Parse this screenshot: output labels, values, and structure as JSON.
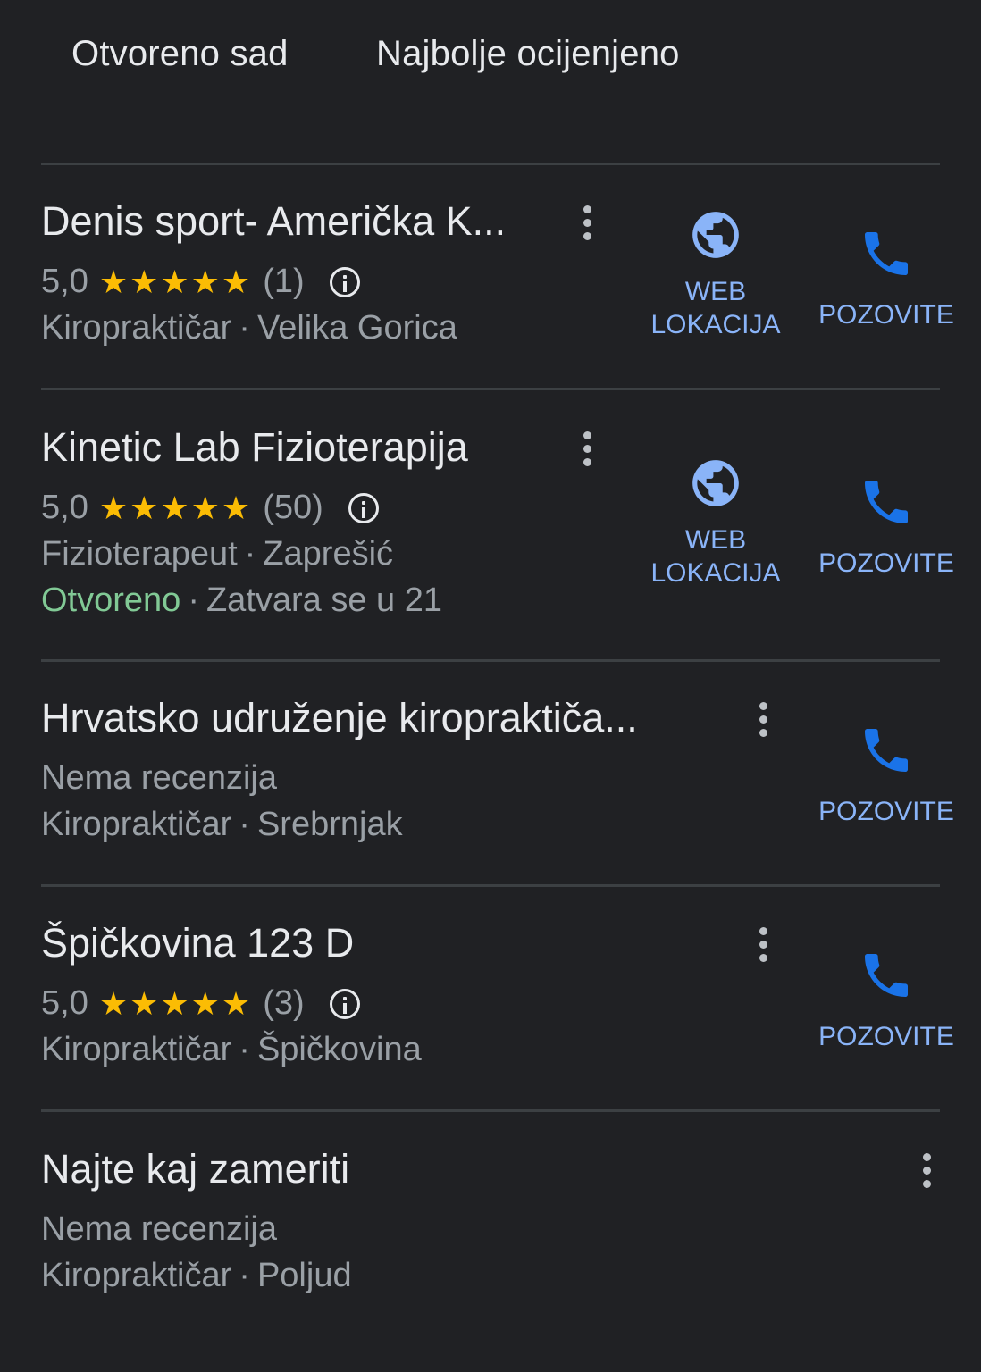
{
  "filters": [
    {
      "label": "Otvoreno sad"
    },
    {
      "label": "Najbolje ocijenjeno"
    }
  ],
  "listings": [
    {
      "name": "Denis sport- Američka K...",
      "rating": "5,0",
      "stars": "★★★★★",
      "count": "(1)",
      "category": "Kiropraktičar",
      "location": "Velika Gorica",
      "separator": "·",
      "web_label_1": "WEB",
      "web_label_2": "LOKACIJA",
      "call_label": "POZOVITE"
    },
    {
      "name": "Kinetic Lab Fizioterapija",
      "rating": "5,0",
      "stars": "★★★★★",
      "count": "(50)",
      "category": "Fizioterapeut",
      "location": "Zaprešić",
      "separator": "·",
      "status_open": "Otvoreno",
      "status_hours": "Zatvara se u 21",
      "web_label_1": "WEB",
      "web_label_2": "LOKACIJA",
      "call_label": "POZOVITE"
    },
    {
      "name": "Hrvatsko udruženje kiropraktiča...",
      "no_reviews": "Nema recenzija",
      "category": "Kiropraktičar",
      "location": "Srebrnjak",
      "separator": "·",
      "call_label": "POZOVITE"
    },
    {
      "name": "Špičkovina 123 D",
      "rating": "5,0",
      "stars": "★★★★★",
      "count": "(3)",
      "category": "Kiropraktičar",
      "location": "Špičkovina",
      "separator": "·",
      "call_label": "POZOVITE"
    },
    {
      "name": "Najte kaj zameriti",
      "no_reviews": "Nema recenzija",
      "category": "Kiropraktičar",
      "location": "Poljud",
      "separator": "·"
    }
  ],
  "colors": {
    "background": "#202124",
    "text": "#e8eaed",
    "secondary": "#9aa0a6",
    "star": "#fbbc04",
    "open": "#81c995",
    "action_text": "#8ab4f8",
    "globe": "#8ab4f8",
    "phone": "#1a73e8"
  },
  "icons": [
    "globe-icon",
    "phone-icon",
    "more-vert-icon",
    "info-icon"
  ]
}
